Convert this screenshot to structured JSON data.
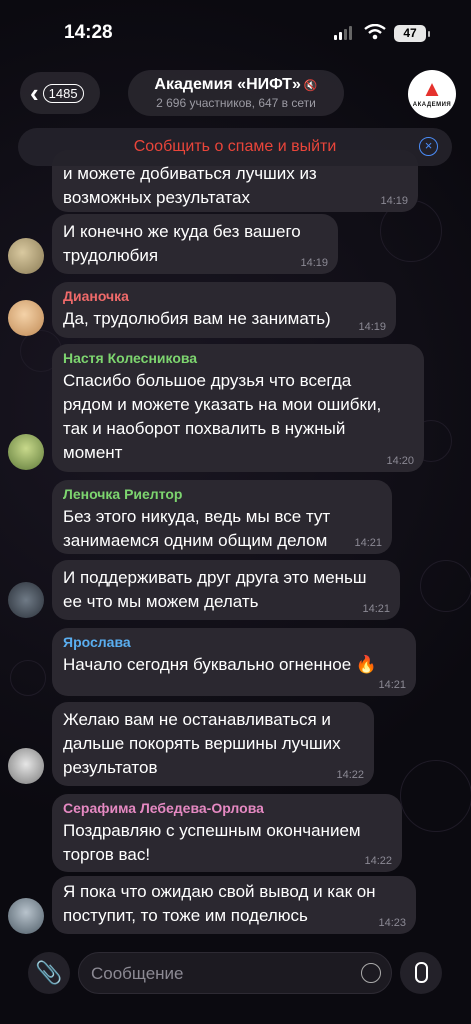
{
  "status": {
    "time": "14:28",
    "battery": "47"
  },
  "header": {
    "back_count": "1485",
    "title": "Академия «НИФТ»",
    "subtitle": "2 696 участников, 647 в сети",
    "logo_text": "АКАДЕМИЯ"
  },
  "spam_bar": {
    "text": "Сообщить о спаме и выйти"
  },
  "messages": [
    {
      "sender": "",
      "lines": [
        "и можете добиваться лучших из",
        "возможных результатах"
      ],
      "time": "14:19"
    },
    {
      "sender": "",
      "lines": [
        "И конечно же куда без вашего",
        "трудолюбия"
      ],
      "time": "14:19"
    },
    {
      "sender": "Дианочка",
      "sender_color": "#ef6a6a",
      "lines": [
        "Да, трудолюбия вам не занимать)"
      ],
      "time": "14:19"
    },
    {
      "sender": "Настя Колесникова",
      "sender_color": "#7dd56f",
      "lines": [
        "Спасибо большое друзья что всегда",
        "рядом и можете указать на мои ошибки,",
        "так и наоборот похвалить в нужный",
        "момент"
      ],
      "time": "14:20"
    },
    {
      "sender": "Леночка Риелтор",
      "sender_color": "#7dd56f",
      "lines": [
        "Без этого никуда, ведь мы все тут",
        "занимаемся одним общим делом"
      ],
      "time": "14:21"
    },
    {
      "sender": "",
      "lines": [
        "И поддерживать друг друга это меньш",
        "ее что мы можем делать"
      ],
      "time": "14:21"
    },
    {
      "sender": "Ярослава",
      "sender_color": "#5aaef0",
      "lines": [
        "Начало сегодня буквально огненное 🔥"
      ],
      "time": "14:21"
    },
    {
      "sender": "",
      "lines": [
        "Желаю вам не останавливаться и",
        "дальше покорять вершины лучших",
        "результатов"
      ],
      "time": "14:22"
    },
    {
      "sender": "Серафима Лебедева-Орлова",
      "sender_color": "#e589c2",
      "lines": [
        "Поздравляю с успешным окончанием",
        "торгов вас!"
      ],
      "time": "14:22"
    },
    {
      "sender": "",
      "lines": [
        "Я пока что ожидаю свой вывод и как он",
        "поступит, то тоже им поделюсь"
      ],
      "time": "14:23"
    }
  ],
  "composer": {
    "placeholder": "Сообщение"
  }
}
